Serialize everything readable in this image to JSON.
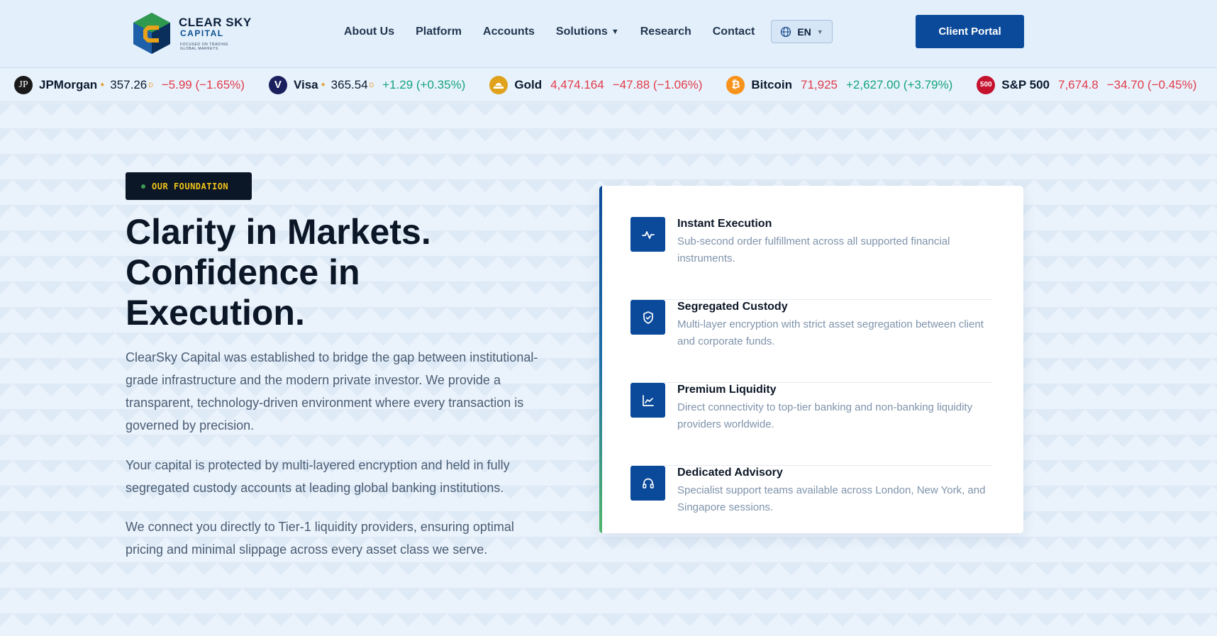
{
  "header": {
    "logo": {
      "name": "CLEAR SKY",
      "sub": "CAPITAL",
      "tagline": "FOCUSED ON TRADING GLOBAL MARKETS"
    },
    "nav": [
      {
        "label": "About Us"
      },
      {
        "label": "Platform"
      },
      {
        "label": "Accounts"
      },
      {
        "label": "Solutions"
      },
      {
        "label": "Research"
      },
      {
        "label": "Contact"
      }
    ],
    "language": "EN",
    "portal_button": "Client Portal"
  },
  "ticker": [
    {
      "icon_text": "JP",
      "name": "JPMorgan",
      "price": "357.26",
      "sup": "D",
      "change": "−5.99 (−1.65%)",
      "direction": "down",
      "icon_color": "#1a1a1a"
    },
    {
      "icon_text": "V",
      "name": "Visa",
      "price": "365.54",
      "sup": "D",
      "change": "+1.29 (+0.35%)",
      "direction": "up",
      "icon_color": "#1a1f5e"
    },
    {
      "icon_text": "",
      "name": "Gold",
      "price": "4,474.164",
      "change": "−47.88 (−1.06%)",
      "direction": "down",
      "icon_color": "#e0a21b"
    },
    {
      "icon_text": "₿",
      "name": "Bitcoin",
      "price": "71,925",
      "change": "+2,627.00 (+3.79%)",
      "direction": "up",
      "icon_color": "#f7931a"
    },
    {
      "icon_text": "500",
      "name": "S&P 500",
      "price": "7,674.8",
      "change": "−34.70 (−0.45%)",
      "direction": "down",
      "icon_color": "#c4122f"
    }
  ],
  "hero": {
    "badge": "OUR FOUNDATION",
    "headline": [
      "Clarity in Markets.",
      "Confidence in",
      "Execution."
    ],
    "paragraphs": [
      "ClearSky Capital was established to bridge the gap between institutional-grade infrastructure and the modern private investor. We provide a transparent, technology-driven environment where every transaction is governed by precision.",
      "Your capital is protected by multi-layered encryption and held in fully segregated custody accounts at leading global banking institutions.",
      "We connect you directly to Tier-1 liquidity providers, ensuring optimal pricing and minimal slippage across every asset class we serve."
    ]
  },
  "features": [
    {
      "icon": "activity-icon",
      "title": "Instant Execution",
      "desc": "Sub-second order fulfillment across all supported financial instruments."
    },
    {
      "icon": "shield-check-icon",
      "title": "Segregated Custody",
      "desc": "Multi-layer encryption with strict asset segregation between client and corporate funds."
    },
    {
      "icon": "line-chart-icon",
      "title": "Premium Liquidity",
      "desc": "Direct connectivity to top-tier banking and non-banking liquidity providers worldwide."
    },
    {
      "icon": "headset-icon",
      "title": "Dedicated Advisory",
      "desc": "Specialist support teams available across London, New York, and Singapore sessions."
    }
  ],
  "colors": {
    "brand": "#0b4a9a",
    "dark": "#0b1626",
    "up": "#16a37e",
    "down": "#e23b4a",
    "badge_text": "#f0c419"
  }
}
